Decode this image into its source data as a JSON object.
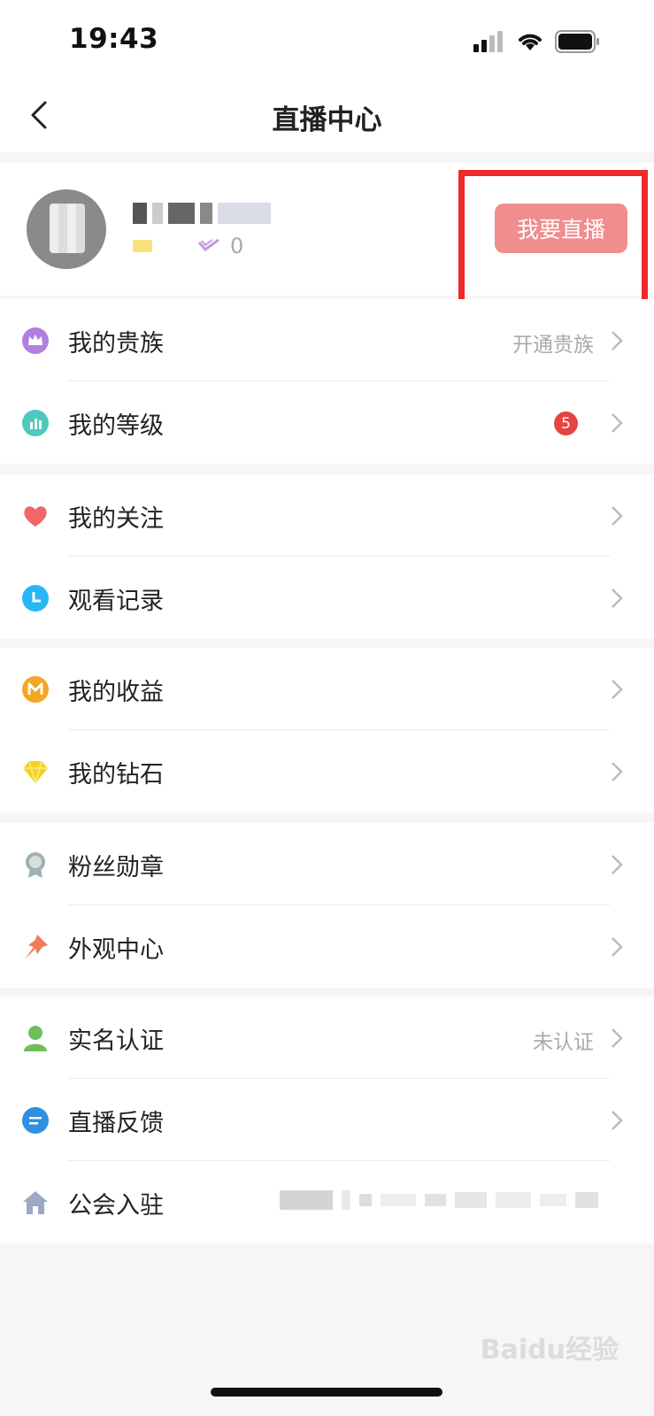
{
  "status_bar": {
    "time": "19:43",
    "icons": [
      "signal-icon",
      "wifi-icon",
      "battery-icon"
    ]
  },
  "nav": {
    "title": "直播中心",
    "back_icon": "chevron-left-icon"
  },
  "profile": {
    "fans_count": "0",
    "live_button_label": "我要直播",
    "live_button_color": "#f08d8d",
    "highlight_color": "#ee2a2a"
  },
  "groups": [
    {
      "items": [
        {
          "label": "我的贵族",
          "value": "开通贵族",
          "icon": "crown-icon",
          "icon_color": "#b07fe0"
        },
        {
          "label": "我的等级",
          "badge": "5",
          "icon": "level-icon",
          "icon_color": "#4fc9be"
        }
      ]
    },
    {
      "items": [
        {
          "label": "我的关注",
          "icon": "heart-icon",
          "icon_color": "#f06767"
        },
        {
          "label": "观看记录",
          "icon": "clock-icon",
          "icon_color": "#29b6f6"
        }
      ]
    },
    {
      "items": [
        {
          "label": "我的收益",
          "icon": "coin-icon",
          "icon_color": "#f5a623"
        },
        {
          "label": "我的钻石",
          "icon": "diamond-icon",
          "icon_color": "#f7d21c"
        }
      ]
    },
    {
      "items": [
        {
          "label": "粉丝勋章",
          "icon": "medal-icon",
          "icon_color": "#9fb0b0"
        },
        {
          "label": "外观中心",
          "icon": "pin-icon",
          "icon_color": "#f07a5a"
        }
      ]
    },
    {
      "items": [
        {
          "label": "实名认证",
          "value": "未认证",
          "icon": "user-icon",
          "icon_color": "#6cbf5b"
        },
        {
          "label": "直播反馈",
          "icon": "message-icon",
          "icon_color": "#2f8fe0"
        },
        {
          "label": "公会入驻",
          "icon": "house-icon",
          "icon_color": "#9ea7c4"
        }
      ]
    }
  ],
  "watermark": "Baidu经验"
}
